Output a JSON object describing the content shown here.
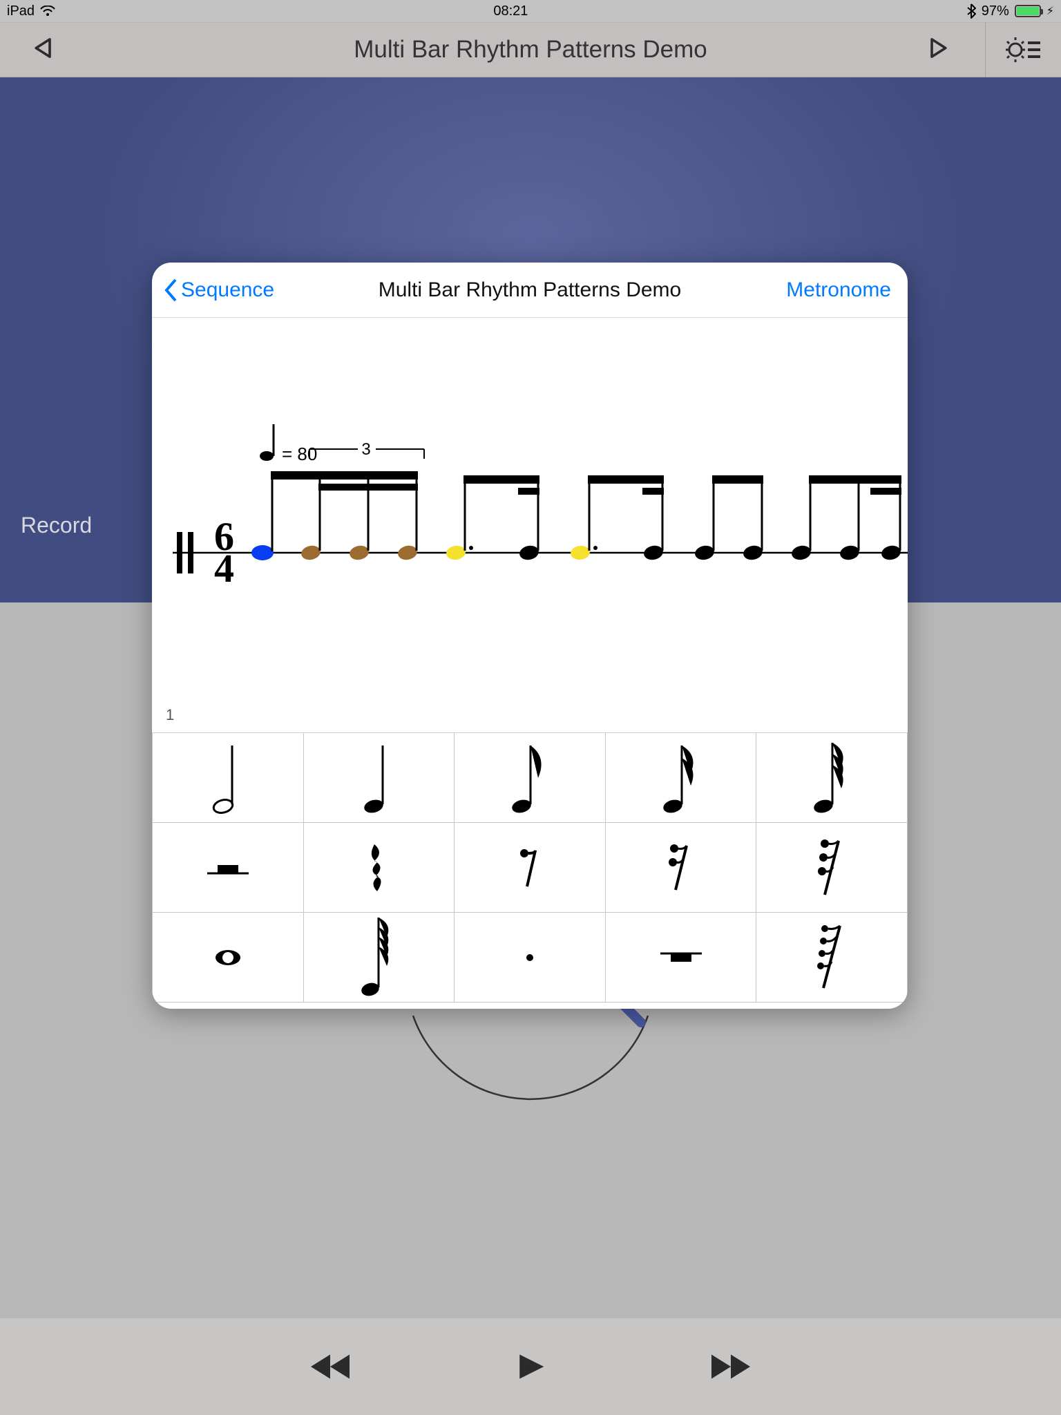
{
  "status": {
    "device": "iPad",
    "time": "08:21",
    "battery_pct": "97%"
  },
  "nav": {
    "title": "Multi Bar Rhythm Patterns Demo"
  },
  "record_label": "Record",
  "popover": {
    "back": "Sequence",
    "title": "Multi Bar Rhythm Patterns Demo",
    "right": "Metronome",
    "tempo_label": " = 80",
    "tuplet_label": "3",
    "time_sig_top": "6",
    "time_sig_bottom": "4",
    "page": "1"
  },
  "palette": {
    "rows": [
      [
        {
          "name": "half-note"
        },
        {
          "name": "quarter-note"
        },
        {
          "name": "eighth-note"
        },
        {
          "name": "sixteenth-note"
        },
        {
          "name": "thirtysecond-note"
        }
      ],
      [
        {
          "name": "half-rest"
        },
        {
          "name": "quarter-rest"
        },
        {
          "name": "eighth-rest"
        },
        {
          "name": "sixteenth-rest"
        },
        {
          "name": "thirtysecond-rest"
        }
      ],
      [
        {
          "name": "whole-note"
        },
        {
          "name": "sixtyfourth-note"
        },
        {
          "name": "dot"
        },
        {
          "name": "whole-rest"
        },
        {
          "name": "sixtyfourth-rest"
        }
      ]
    ]
  },
  "colors": {
    "ios_blue": "#007aff",
    "note_blue": "#083ef0",
    "note_brown": "#9c6b2f",
    "note_yellow": "#f4e22f"
  }
}
